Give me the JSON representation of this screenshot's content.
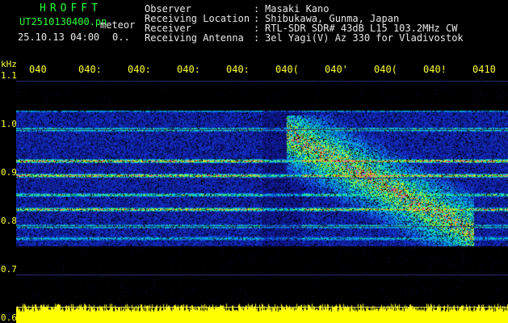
{
  "header": {
    "brand": "HROFFT",
    "filename": "UT2510130400.pn",
    "meteor_label": "meteor",
    "datetime": "25.10.13 04:00",
    "count": "0..",
    "info_keys": [
      "Observer",
      "Receiving Location",
      "Receiver",
      "Receiving Antenna"
    ],
    "info_sep": ":",
    "info_values": [
      "Masaki Kano",
      "Shibukawa, Gunma, Japan",
      "RTL-SDR SDR# 43dB L15 103.2MHz CW",
      "3el Yagi(V) Az 330 for Vladivostok"
    ]
  },
  "colors": {
    "background": "#000000",
    "tick_text": "#ffff33",
    "header_green": "#2aff3a",
    "header_white": "#e8e8e8",
    "grid": "#2a2a7a",
    "noise_band": "#ffff00"
  },
  "chart_data": {
    "type": "heatmap",
    "title": "",
    "ylabel": "kHz",
    "xlabel": "",
    "x_tick_labels": [
      "040",
      "040:",
      "040:",
      "040:",
      "040:",
      "040(",
      "040'",
      "040(",
      "040!",
      "0410"
    ],
    "y_tick_labels": [
      "1.1",
      "1.0",
      "0.9",
      "0.8",
      "0.7",
      "0.6"
    ],
    "y_ticks": [
      1.1,
      1.0,
      0.9,
      0.8,
      0.7,
      0.6
    ],
    "ylim": [
      0.6,
      1.1
    ],
    "x_range_minutes": [
      0,
      10
    ],
    "signal_band_khz": [
      0.76,
      1.04
    ],
    "horizontal_lines_khz": [
      {
        "freq": 1.04,
        "strength": 0.55
      },
      {
        "freq": 1.0,
        "strength": 0.7
      },
      {
        "freq": 0.935,
        "strength": 0.95
      },
      {
        "freq": 0.905,
        "strength": 0.9
      },
      {
        "freq": 0.865,
        "strength": 0.6
      },
      {
        "freq": 0.835,
        "strength": 0.85
      },
      {
        "freq": 0.8,
        "strength": 0.65
      },
      {
        "freq": 0.775,
        "strength": 0.4
      }
    ],
    "meteor_echo": {
      "start_minute": 5.5,
      "end_minute": 9.3,
      "freq_top_khz": 1.03,
      "freq_bottom_khz": 0.76
    },
    "noise_floor_khz": 0.6
  }
}
